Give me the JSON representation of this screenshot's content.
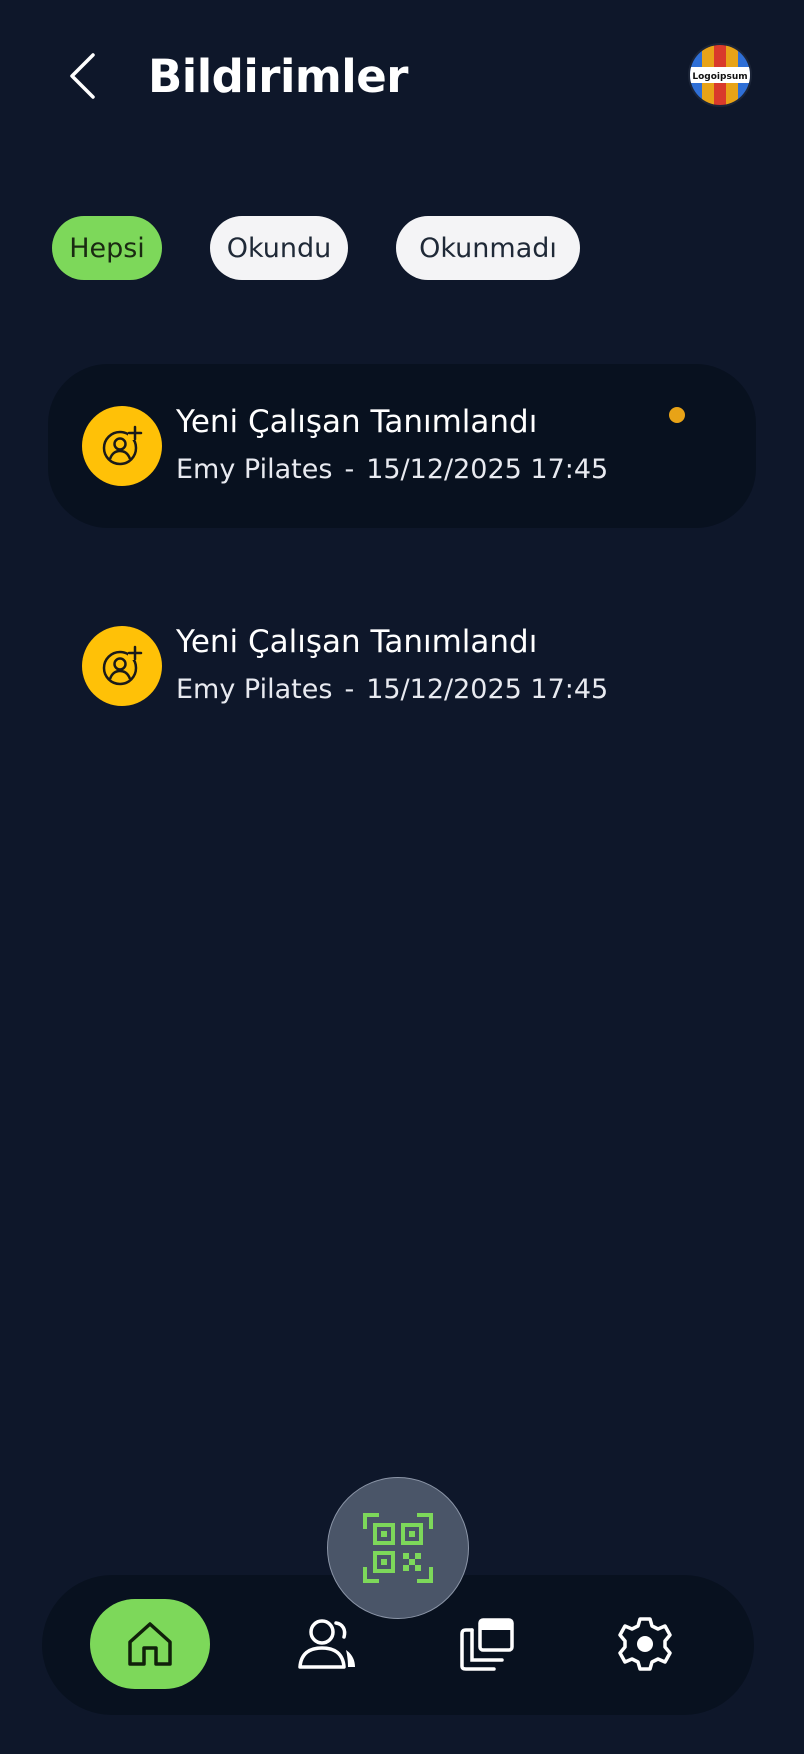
{
  "header": {
    "title": "Bildirimler",
    "back_icon": "chevron-left-icon",
    "avatar_logo_text": "Logoipsum"
  },
  "filters": [
    {
      "label": "Hepsi",
      "active": true
    },
    {
      "label": "Okundu",
      "active": false
    },
    {
      "label": "Okunmadı",
      "active": false
    }
  ],
  "notifications": [
    {
      "title": "Yeni Çalışan Tanımlandı",
      "source": "Emy Pilates",
      "separator": "-",
      "datetime": "15/12/2025 17:45",
      "unread": true,
      "icon": "user-add-icon"
    },
    {
      "title": "Yeni Çalışan Tanımlandı",
      "source": "Emy Pilates",
      "separator": "-",
      "datetime": "15/12/2025 17:45",
      "unread": false,
      "icon": "user-add-icon"
    }
  ],
  "bottom_nav": {
    "items": [
      {
        "icon": "home-icon",
        "active": true
      },
      {
        "icon": "users-icon",
        "active": false
      },
      {
        "icon": "gallery-icon",
        "active": false
      },
      {
        "icon": "gear-icon",
        "active": false
      }
    ],
    "fab_icon": "qr-code-icon"
  },
  "colors": {
    "background": "#0E172A",
    "card": "#08111F",
    "accent_green": "#7DD85A",
    "notif_icon_bg": "#FFC107",
    "unread_dot": "#E8A317",
    "chip_inactive": "#F4F4F6",
    "fab": "#4A5568"
  }
}
